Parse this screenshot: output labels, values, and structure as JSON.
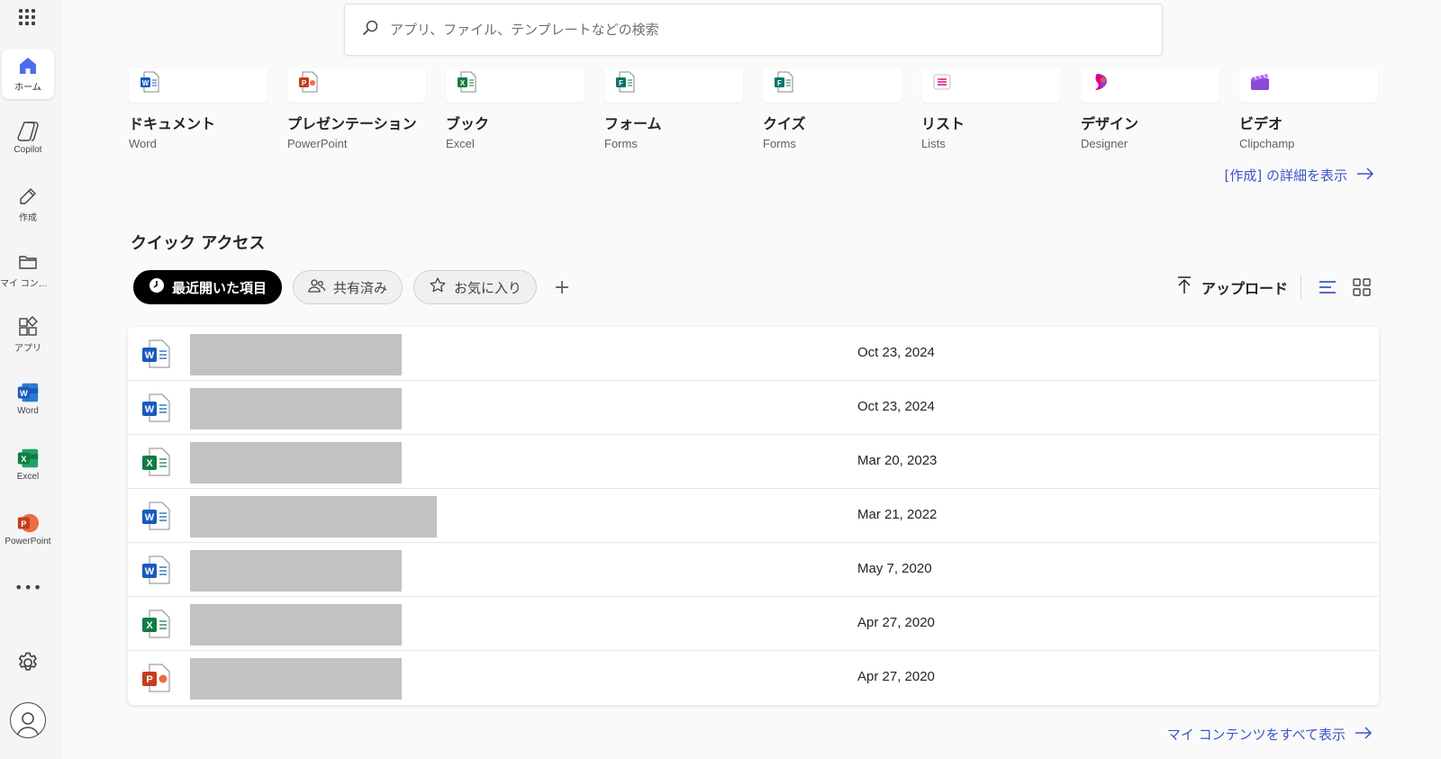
{
  "rail": {
    "items": [
      {
        "label": "ホーム",
        "icon": "home-icon",
        "active": true
      },
      {
        "label": "Copilot",
        "icon": "copilot-icon"
      },
      {
        "label": "作成",
        "icon": "pen-icon"
      },
      {
        "label": "マイ コンテンツ",
        "icon": "folder-icon"
      },
      {
        "label": "アプリ",
        "icon": "apps-icon"
      },
      {
        "label": "Word",
        "icon": "word-icon"
      },
      {
        "label": "Excel",
        "icon": "excel-icon"
      },
      {
        "label": "PowerPoint",
        "icon": "powerpoint-icon"
      }
    ],
    "more": "•••"
  },
  "search": {
    "placeholder": "アプリ、ファイル、テンプレートなどの検索"
  },
  "create": {
    "cards": [
      {
        "title": "ドキュメント",
        "app": "Word",
        "icon": "word-icon",
        "color": "#185abd"
      },
      {
        "title": "プレゼンテーション",
        "app": "PowerPoint",
        "icon": "powerpoint-icon",
        "color": "#c43e1c"
      },
      {
        "title": "ブック",
        "app": "Excel",
        "icon": "excel-icon",
        "color": "#107c41"
      },
      {
        "title": "フォーム",
        "app": "Forms",
        "icon": "forms-icon",
        "color": "#077568"
      },
      {
        "title": "クイズ",
        "app": "Forms",
        "icon": "forms-icon",
        "color": "#077568"
      },
      {
        "title": "リスト",
        "app": "Lists",
        "icon": "lists-icon",
        "color": "#e3008c"
      },
      {
        "title": "デザイン",
        "app": "Designer",
        "icon": "designer-icon",
        "color": "#7a42f4"
      },
      {
        "title": "ビデオ",
        "app": "Clipchamp",
        "icon": "clipchamp-icon",
        "color": "#8a4bd8"
      }
    ],
    "more_link": "[作成] の詳細を表示"
  },
  "quick_access": {
    "title": "クイック アクセス",
    "filters": [
      {
        "label": "最近開いた項目",
        "icon": "clock-icon",
        "active": true
      },
      {
        "label": "共有済み",
        "icon": "people-icon"
      },
      {
        "label": "お気に入り",
        "icon": "star-icon"
      }
    ],
    "add": "+",
    "upload_label": "アップロード",
    "files": [
      {
        "type": "word",
        "date": "Oct 23, 2024",
        "name_width": 235
      },
      {
        "type": "word",
        "date": "Oct 23, 2024",
        "name_width": 235
      },
      {
        "type": "excel",
        "date": "Mar 20, 2023",
        "name_width": 235
      },
      {
        "type": "word",
        "date": "Mar 21, 2022",
        "name_width": 274
      },
      {
        "type": "word",
        "date": "May 7, 2020",
        "name_width": 235
      },
      {
        "type": "excel",
        "date": "Apr 27, 2020",
        "name_width": 235
      },
      {
        "type": "powerpoint",
        "date": "Apr 27, 2020",
        "name_width": 235
      }
    ],
    "all_content_link": "マイ コンテンツをすべて表示"
  },
  "colors": {
    "accent": "#3a55c8",
    "word": "#185abd",
    "excel": "#107c41",
    "powerpoint": "#c43e1c"
  }
}
